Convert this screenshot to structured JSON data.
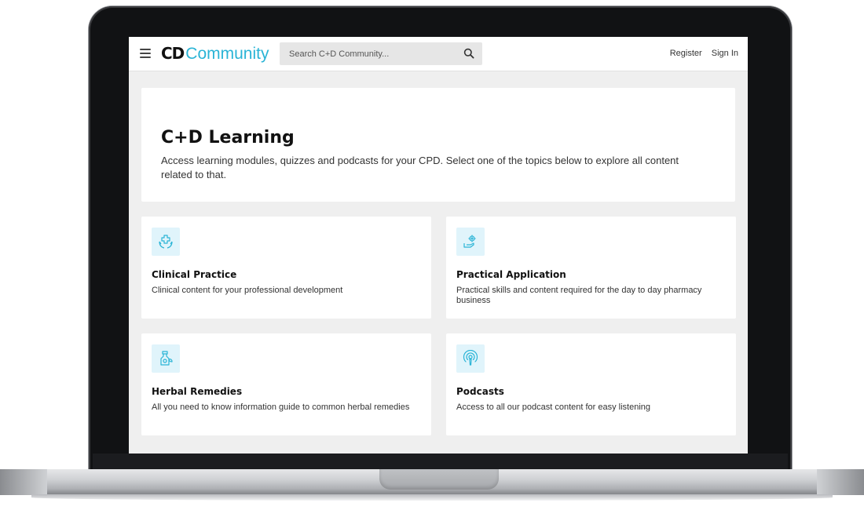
{
  "header": {
    "logo_mark": "CD",
    "logo_word": "Community",
    "search_placeholder": "Search C+D Community...",
    "register_label": "Register",
    "signin_label": "Sign In"
  },
  "hero": {
    "title": "C+D Learning",
    "description": "Access learning modules, quizzes and podcasts for your CPD. Select one of the topics below to explore all content related to that."
  },
  "topics": [
    {
      "title": "Clinical Practice",
      "description": "Clinical content for your professional development",
      "icon": "hands-medical-cross-icon"
    },
    {
      "title": "Practical Application",
      "description": "Practical skills and content required for the day to day pharmacy business",
      "icon": "hand-gear-icon"
    },
    {
      "title": "Herbal Remedies",
      "description": "All you need to know information guide to common herbal remedies",
      "icon": "herbal-bottle-icon"
    },
    {
      "title": "Podcasts",
      "description": "Access to all our podcast content for easy listening",
      "icon": "podcast-icon"
    }
  ],
  "colors": {
    "brand_accent": "#2ab4d6",
    "icon_background": "#e0f4fb",
    "page_background": "#efefef"
  }
}
